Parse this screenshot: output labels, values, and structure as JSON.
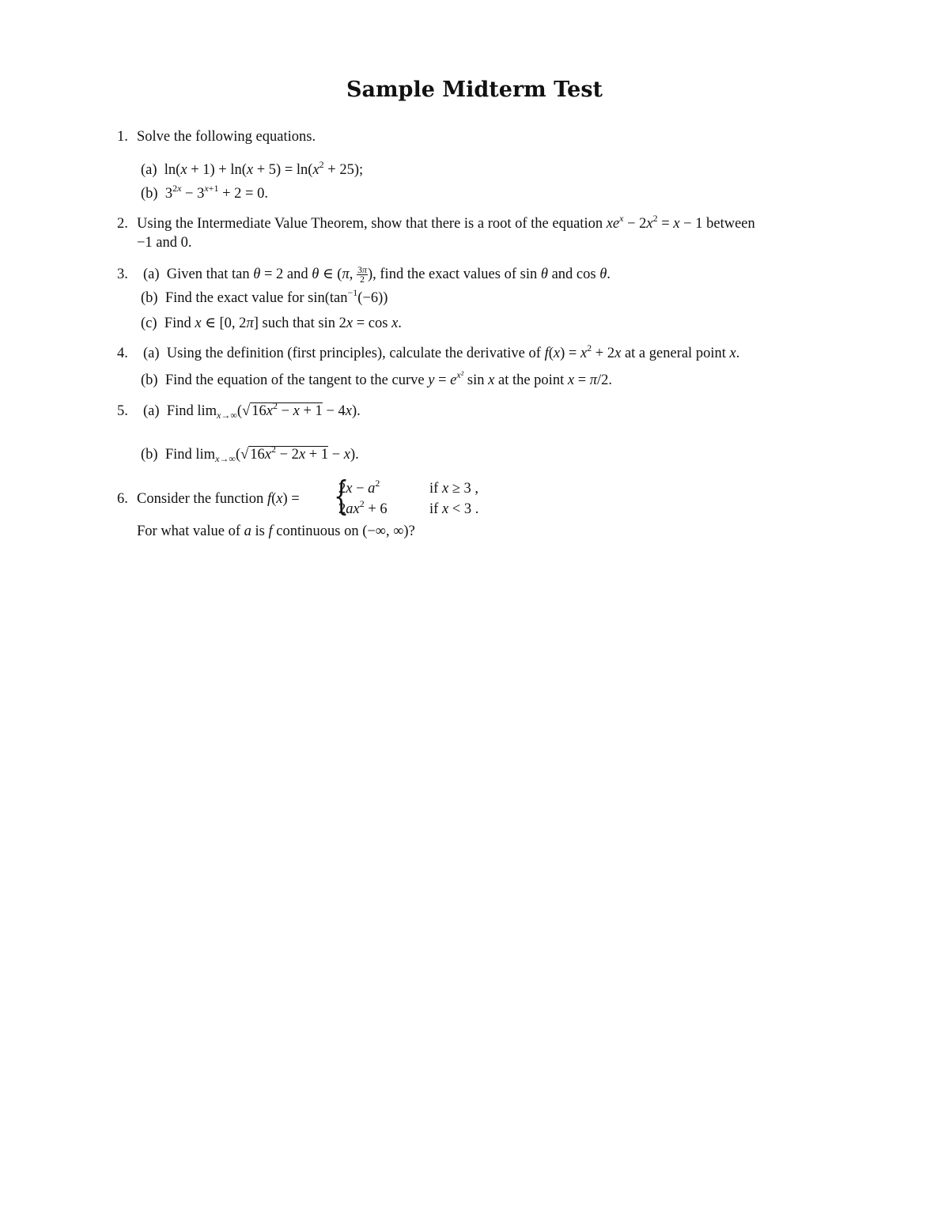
{
  "document": {
    "title": "Sample Midterm Test",
    "questions": [
      {
        "number": "1.",
        "prompt": "Solve the following equations.",
        "parts": [
          {
            "label": "(a)",
            "text": "ln(x + 1) + ln(x + 5) = ln(x² + 25);"
          },
          {
            "label": "(b)",
            "text": "3^(2x) − 3^(x+1) + 2 = 0."
          }
        ]
      },
      {
        "number": "2.",
        "prompt_line1": "Using the Intermediate Value Theorem, show that there is a root of the equation xe^x − 2x² = x − 1 between",
        "prompt_line2": "−1 and 0."
      },
      {
        "number": "3.",
        "parts": [
          {
            "label": "(a)",
            "text": "Given that tan θ = 2 and θ ∈ (π, 3π/2), find the exact values of sin θ and cos θ."
          },
          {
            "label": "(b)",
            "text": "Find the exact value for sin(tan⁻¹(−6))"
          },
          {
            "label": "(c)",
            "text": "Find x ∈ [0, 2π] such that sin 2x = cos x."
          }
        ]
      },
      {
        "number": "4.",
        "parts": [
          {
            "label": "(a)",
            "text": "Using the definition (first principles), calculate the derivative of f(x) = x² + 2x at a general point x."
          },
          {
            "label": "(b)",
            "text": "Find the equation of the tangent to the curve y = e^(x²) sin x at the point x = π/2."
          }
        ]
      },
      {
        "number": "5.",
        "parts": [
          {
            "label": "(a)",
            "text": "Find lim x→∞ (√(16x² − x + 1) − 4x)."
          },
          {
            "label": "(b)",
            "text": "Find lim x→∞ (√(16x² − 2x + 1) − x)."
          }
        ]
      },
      {
        "number": "6.",
        "prompt": "Consider the function f(x) =",
        "cases": [
          {
            "expr": "2x − a²",
            "cond": "if x ≥ 3 ,"
          },
          {
            "expr": "2ax² + 6",
            "cond": "if x < 3 ."
          }
        ],
        "followup": "For what value of a is f continuous on (−∞, ∞)?"
      }
    ]
  }
}
